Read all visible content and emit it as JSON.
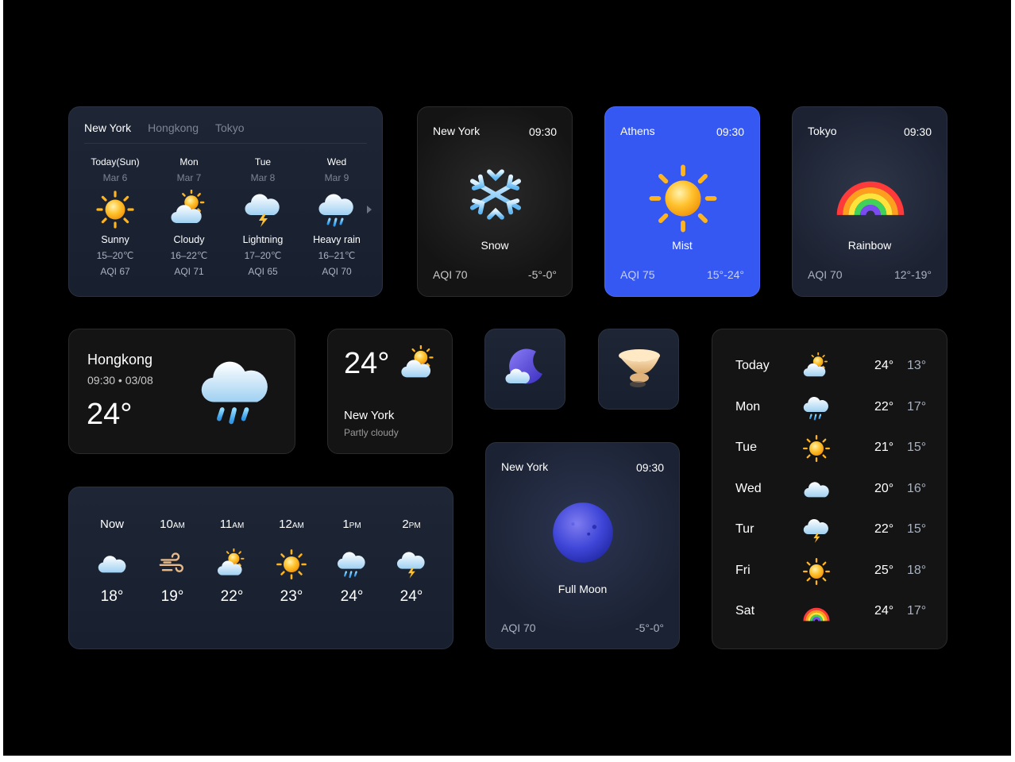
{
  "colors": {
    "canvas": "#000000",
    "navy_card": "#1e2636",
    "dark_card": "#141414",
    "athens_blue": "#3557f2",
    "sun": "#ffb41e",
    "moon": "#3f46d8"
  },
  "forecast": {
    "tabs": [
      "New York",
      "Hongkong",
      "Tokyo"
    ],
    "active_tab": "New York",
    "days": [
      {
        "day": "Today(Sun)",
        "date": "Mar 6",
        "icon": "sun-icon",
        "condition": "Sunny",
        "temp": "15–20℃",
        "aqi": "AQI 67"
      },
      {
        "day": "Mon",
        "date": "Mar 7",
        "icon": "sun-cloud-icon",
        "condition": "Cloudy",
        "temp": "16–22℃",
        "aqi": "AQI 71"
      },
      {
        "day": "Tue",
        "date": "Mar 8",
        "icon": "lightning-cloud-icon",
        "condition": "Lightning",
        "temp": "17–20℃",
        "aqi": "AQI 65"
      },
      {
        "day": "Wed",
        "date": "Mar 9",
        "icon": "rain-cloud-icon",
        "condition": "Heavy rain",
        "temp": "16–21℃",
        "aqi": "AQI 70"
      }
    ]
  },
  "tile_snow": {
    "city": "New York",
    "time": "09:30",
    "icon": "snowflake-icon",
    "condition": "Snow",
    "aqi": "AQI 70",
    "range": "-5°-0°"
  },
  "tile_athens": {
    "city": "Athens",
    "time": "09:30",
    "icon": "sun-icon",
    "condition": "Mist",
    "aqi": "AQI 75",
    "range": "15°-24°"
  },
  "tile_tokyo": {
    "city": "Tokyo",
    "time": "09:30",
    "icon": "rainbow-icon",
    "condition": "Rainbow",
    "aqi": "AQI 70",
    "range": "12°-19°"
  },
  "hongkong": {
    "city": "Hongkong",
    "datetime": "09:30 • 03/08",
    "temp": "24°",
    "icon": "rain-cloud-icon"
  },
  "small_ny": {
    "temp": "24°",
    "city": "New York",
    "condition": "Partly cloudy",
    "icon": "sun-cloud-icon"
  },
  "mini_icons": [
    "moon-cloud-icon",
    "tornado-icon"
  ],
  "moon_tile": {
    "city": "New York",
    "time": "09:30",
    "icon": "full-moon-icon",
    "condition": "Full Moon",
    "aqi": "AQI 70",
    "range": "-5°-0°"
  },
  "hourly": [
    {
      "hour": "Now",
      "suffix": "",
      "icon": "cloud-icon",
      "temp": "18°"
    },
    {
      "hour": "10",
      "suffix": "AM",
      "icon": "wind-icon",
      "temp": "19°"
    },
    {
      "hour": "11",
      "suffix": "AM",
      "icon": "sun-cloud-icon",
      "temp": "22°"
    },
    {
      "hour": "12",
      "suffix": "AM",
      "icon": "sun-icon",
      "temp": "23°"
    },
    {
      "hour": "1",
      "suffix": "PM",
      "icon": "rain-cloud-icon",
      "temp": "24°"
    },
    {
      "hour": "2",
      "suffix": "PM",
      "icon": "lightning-cloud-icon",
      "temp": "24°"
    }
  ],
  "weekly": [
    {
      "day": "Today",
      "icon": "sun-cloud-icon",
      "high": "24°",
      "low": "13°"
    },
    {
      "day": "Mon",
      "icon": "rain-cloud-icon",
      "high": "22°",
      "low": "17°"
    },
    {
      "day": "Tue",
      "icon": "sun-icon",
      "high": "21°",
      "low": "15°"
    },
    {
      "day": "Wed",
      "icon": "cloud-icon",
      "high": "20°",
      "low": "16°"
    },
    {
      "day": "Tur",
      "icon": "lightning-cloud-icon",
      "high": "22°",
      "low": "15°"
    },
    {
      "day": "Fri",
      "icon": "sun-icon",
      "high": "25°",
      "low": "18°"
    },
    {
      "day": "Sat",
      "icon": "rainbow-icon",
      "high": "24°",
      "low": "17°"
    }
  ]
}
